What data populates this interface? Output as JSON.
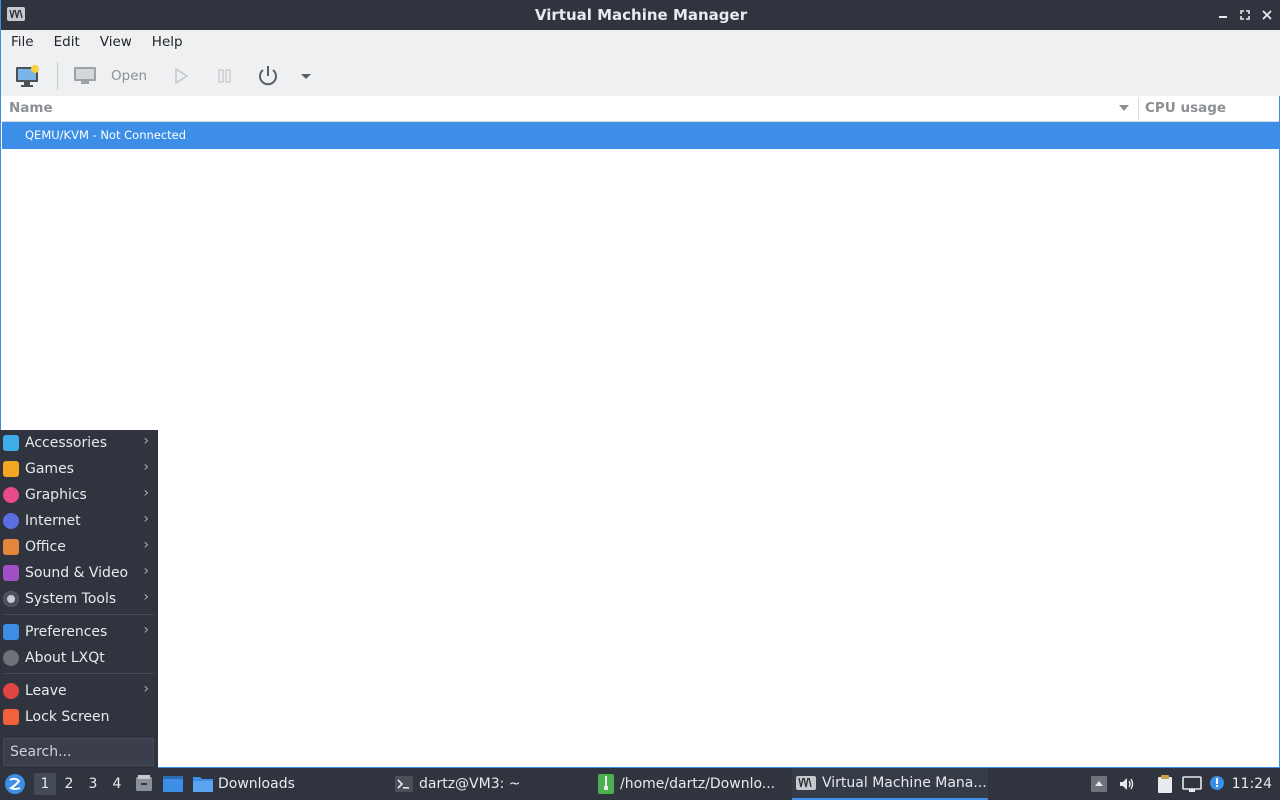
{
  "window": {
    "title": "Virtual Machine Manager"
  },
  "menubar": {
    "items": [
      "File",
      "Edit",
      "View",
      "Help"
    ]
  },
  "toolbar": {
    "open_label": "Open"
  },
  "columns": {
    "name": "Name",
    "cpu": "CPU usage"
  },
  "connections": [
    {
      "label": "QEMU/KVM - Not Connected",
      "selected": true
    }
  ],
  "start_menu": {
    "items": [
      {
        "label": "Accessories",
        "icon": "accessories-icon",
        "submenu": true,
        "color": "#3daee9"
      },
      {
        "label": "Games",
        "icon": "games-icon",
        "submenu": true,
        "color": "#f5a623"
      },
      {
        "label": "Graphics",
        "icon": "graphics-icon",
        "submenu": true,
        "color": "#e84a8a"
      },
      {
        "label": "Internet",
        "icon": "internet-icon",
        "submenu": true,
        "color": "#5b6ee1"
      },
      {
        "label": "Office",
        "icon": "office-icon",
        "submenu": true,
        "color": "#e2873b"
      },
      {
        "label": "Sound & Video",
        "icon": "sound-video-icon",
        "submenu": true,
        "color": "#a04fc6"
      },
      {
        "label": "System Tools",
        "icon": "system-tools-icon",
        "submenu": true,
        "color": "#c9ccd1"
      },
      {
        "label": "Preferences",
        "icon": "preferences-icon",
        "submenu": true,
        "color": "#3d8ee6"
      },
      {
        "label": "About LXQt",
        "icon": "info-icon",
        "submenu": false,
        "color": "#8c8f93"
      },
      {
        "label": "Leave",
        "icon": "power-icon",
        "submenu": true,
        "color": "#e04545"
      },
      {
        "label": "Lock Screen",
        "icon": "lock-icon",
        "submenu": false,
        "color": "#f0623b"
      }
    ],
    "search_placeholder": "Search..."
  },
  "taskbar": {
    "desktops": [
      "1",
      "2",
      "3",
      "4"
    ],
    "active_desktop": "1",
    "quicklaunch": [
      "file-manager-icon",
      "show-desktop-icon"
    ],
    "tasks": [
      {
        "label": "Downloads",
        "icon": "folder-icon",
        "active": false
      },
      {
        "label": "dartz@VM3: ~",
        "icon": "terminal-icon",
        "active": false
      },
      {
        "label": "/home/dartz/Downlo...",
        "icon": "archive-icon",
        "active": false
      },
      {
        "label": "Virtual Machine Mana...",
        "icon": "virt-manager-icon",
        "active": true
      }
    ],
    "tray": [
      "tray-arrow-icon",
      "volume-icon",
      "clipboard-icon",
      "network-icon",
      "updates-icon"
    ],
    "clock": "11:24"
  }
}
